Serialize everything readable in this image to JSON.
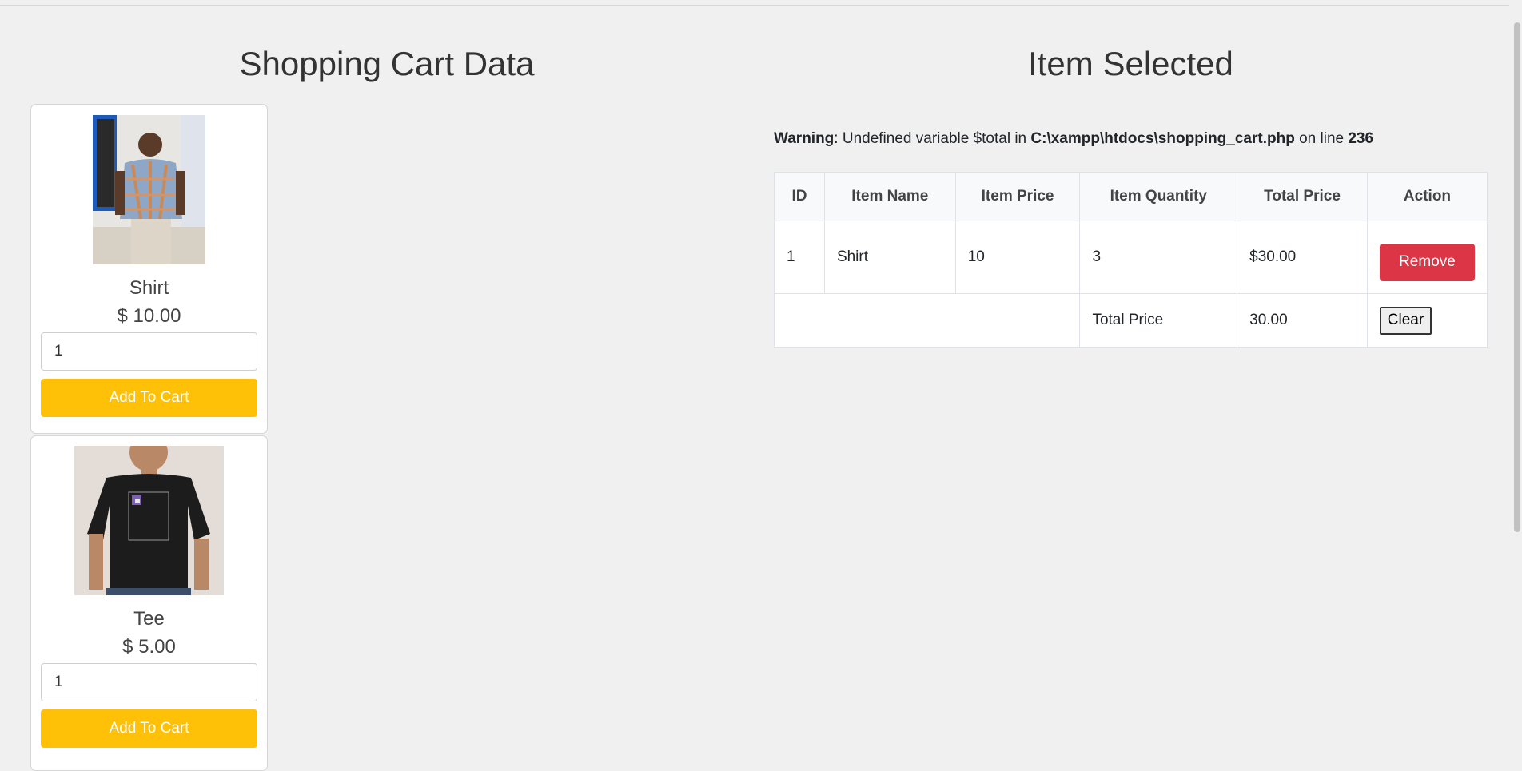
{
  "left": {
    "title": "Shopping Cart Data",
    "products": [
      {
        "name": "Shirt",
        "price": "$ 10.00",
        "qty": "1",
        "button": "Add To Cart"
      },
      {
        "name": "Tee",
        "price": "$ 5.00",
        "qty": "1",
        "button": "Add To Cart"
      }
    ]
  },
  "right": {
    "title": "Item Selected",
    "warning": {
      "label": "Warning",
      "text1": ": Undefined variable $total in ",
      "path": "C:\\xampp\\htdocs\\shopping_cart.php",
      "text2": " on line ",
      "line": "236"
    },
    "table": {
      "headers": [
        "ID",
        "Item Name",
        "Item Price",
        "Item Quantity",
        "Total Price",
        "Action"
      ],
      "rows": [
        {
          "id": "1",
          "name": "Shirt",
          "price": "10",
          "quantity": "3",
          "total": "$30.00",
          "action": "Remove"
        }
      ],
      "footer": {
        "label": "Total Price",
        "value": "30.00",
        "action": "Clear"
      }
    }
  },
  "colors": {
    "add_button": "#ffc107",
    "remove_button": "#dc3545",
    "background": "#f0f0f0"
  }
}
